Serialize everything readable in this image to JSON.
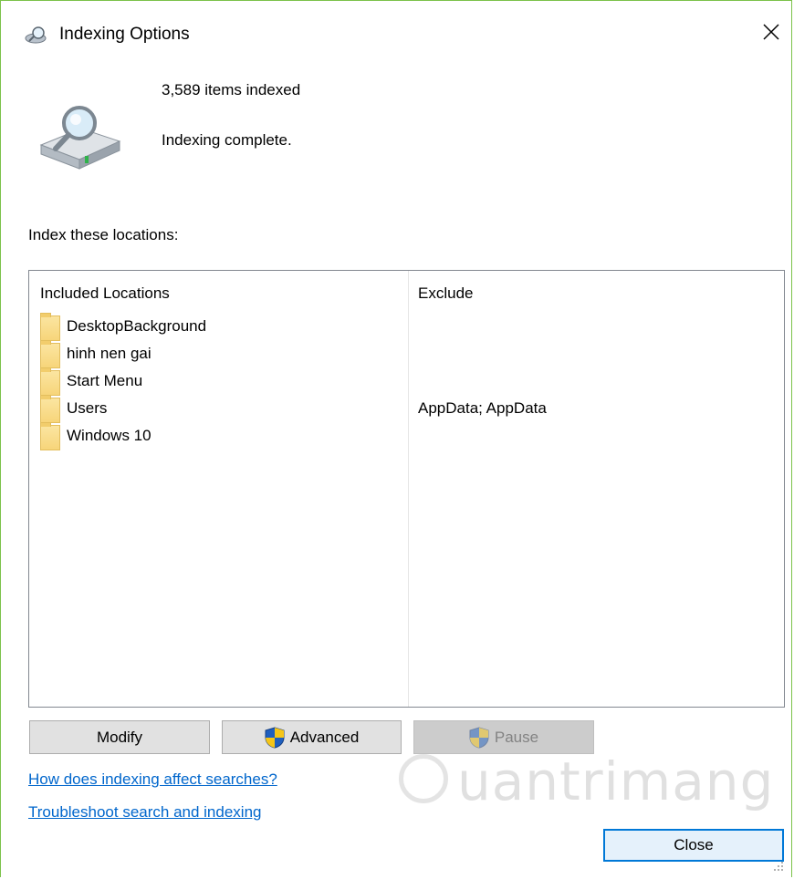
{
  "window": {
    "title": "Indexing Options"
  },
  "status": {
    "items_indexed": "3,589 items indexed",
    "state": "Indexing complete."
  },
  "locations": {
    "label": "Index these locations:",
    "columns": {
      "included": "Included Locations",
      "exclude": "Exclude"
    },
    "rows": [
      {
        "name": "DesktopBackground",
        "exclude": ""
      },
      {
        "name": "hinh nen gai",
        "exclude": ""
      },
      {
        "name": "Start Menu",
        "exclude": ""
      },
      {
        "name": "Users",
        "exclude": "AppData; AppData"
      },
      {
        "name": "Windows 10",
        "exclude": ""
      }
    ]
  },
  "buttons": {
    "modify": "Modify",
    "advanced": "Advanced",
    "pause": "Pause",
    "close": "Close"
  },
  "links": {
    "how": "How does indexing affect searches?",
    "troubleshoot": "Troubleshoot search and indexing"
  },
  "watermark": {
    "text": "uantrimang"
  },
  "colors": {
    "link": "#0066cc",
    "accent": "#0078d7",
    "window_border": "#7cc24a"
  }
}
